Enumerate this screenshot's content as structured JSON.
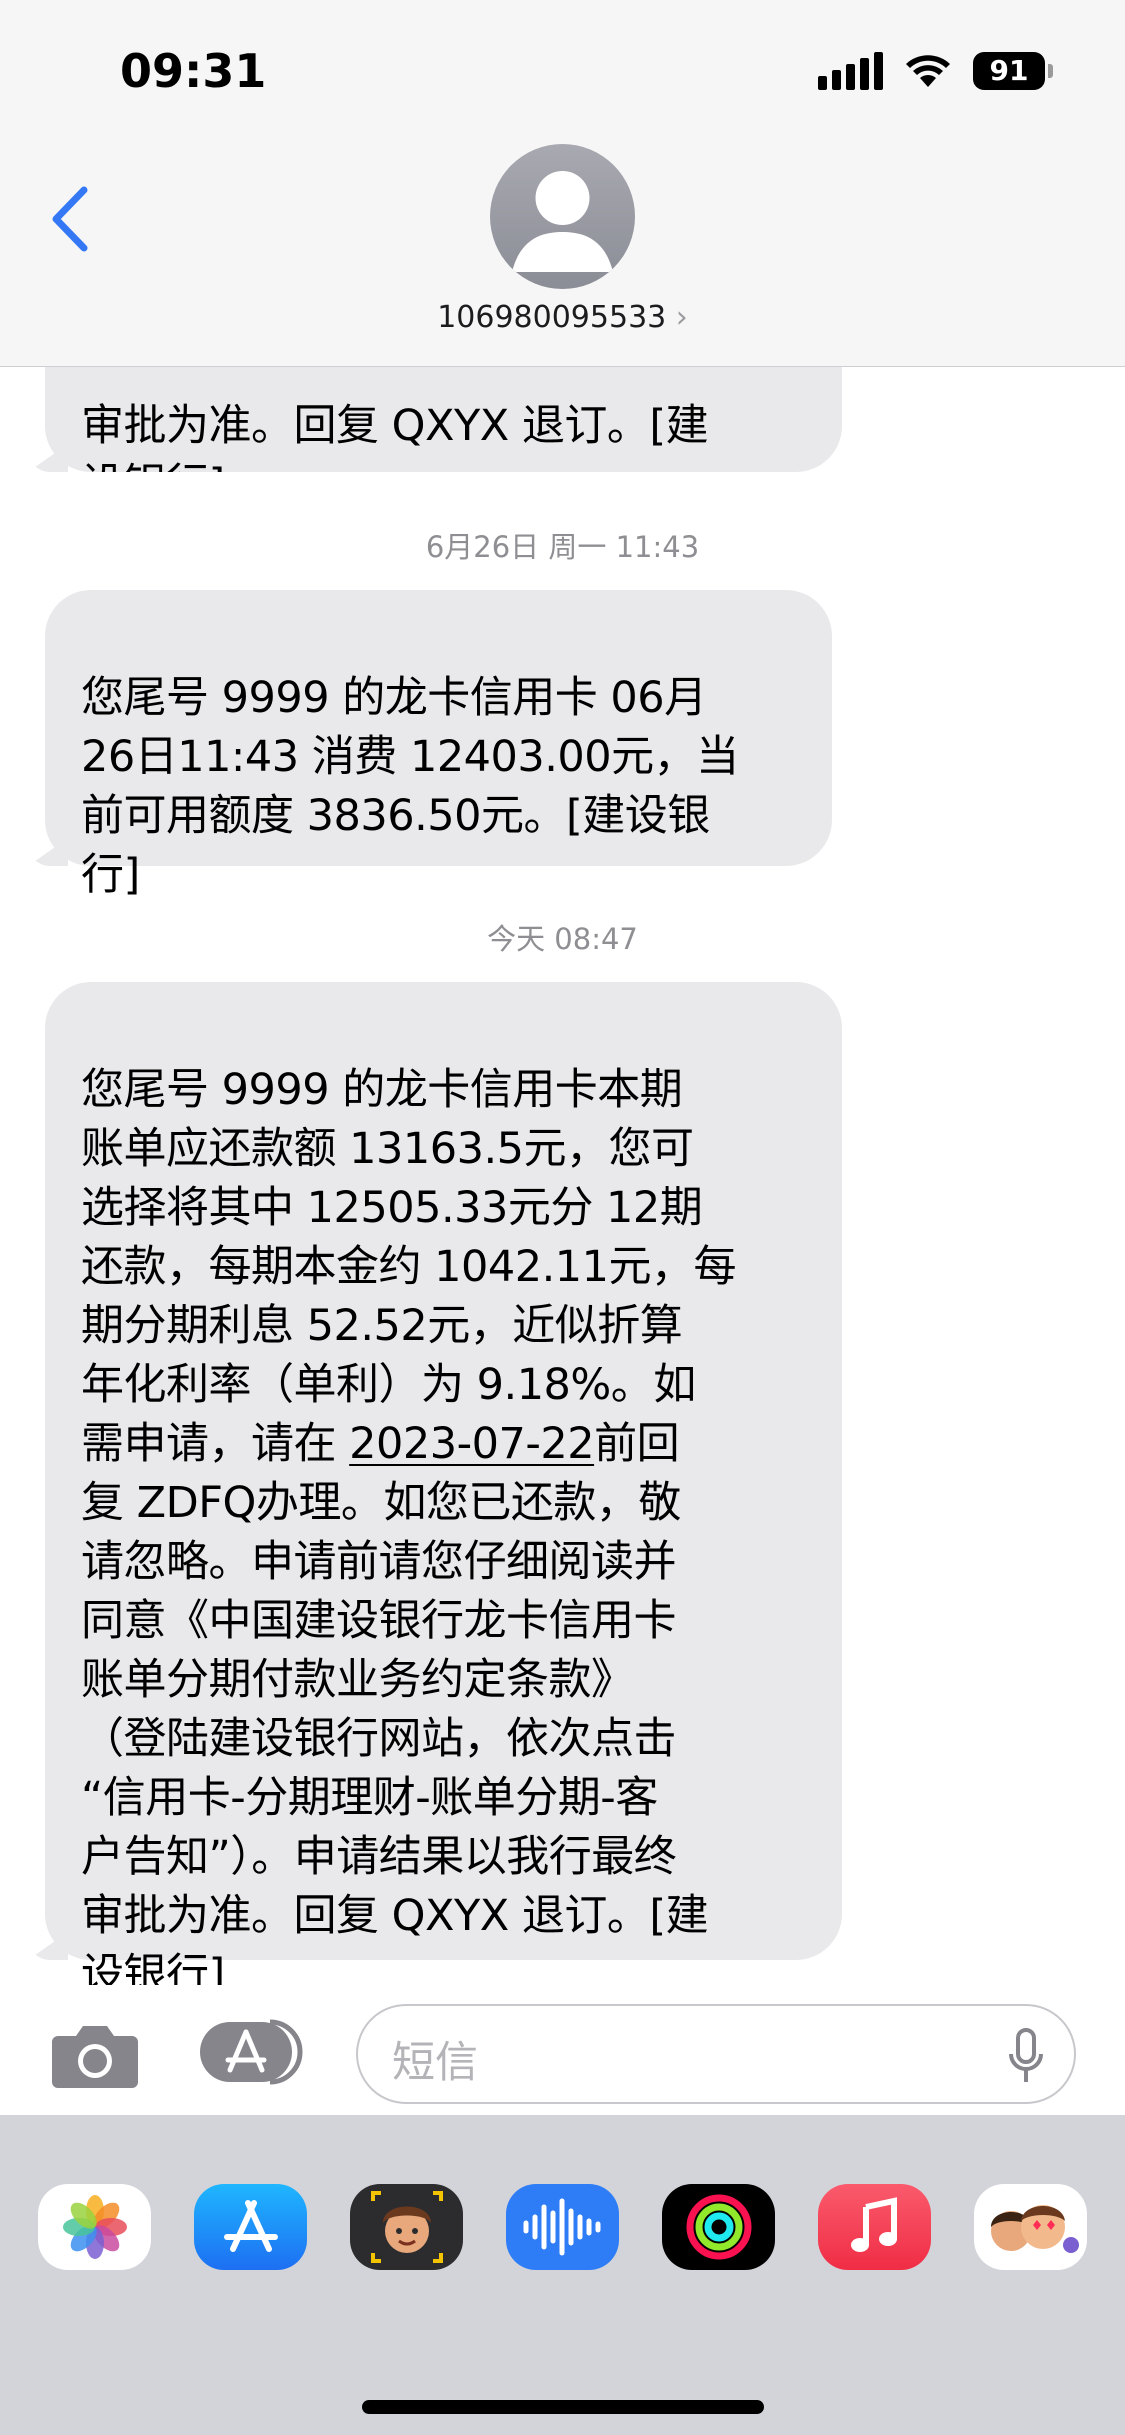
{
  "status_bar": {
    "time": "09:31",
    "battery": "91"
  },
  "header": {
    "contact_number": "106980095533",
    "chevron": "›"
  },
  "thread": {
    "messages": [
      {
        "text": "审批为准。回复 QXYX 退订。[建\n设银行]"
      },
      {
        "text": "您尾号 9999 的龙卡信用卡 06月\n26日11:43 消费 12403.00元，当\n前可用额度 3836.50元。[建设银\n行]"
      }
    ],
    "timestamps": [
      "6月26日 周一 11:43",
      "今天 08:47"
    ],
    "last_message": {
      "before": "您尾号 9999 的龙卡信用卡本期\n账单应还款额 13163.5元，您可\n选择将其中 12505.33元分 12期\n还款，每期本金约 1042.11元，每\n期分期利息 52.52元，近似折算\n年化利率（单利）为 9.18%。如\n需申请，请在 ",
      "date_link": "2023-07-22",
      "after": "前回\n复 ZDFQ办理。如您已还款，敬\n请忽略。申请前请您仔细阅读并\n同意《中国建设银行龙卡信用卡\n账单分期付款业务约定条款》\n（登陆建设银行网站，依次点击\n“信用卡-分期理财-账单分期-客\n户告知”）。申请结果以我行最终\n审批为准。回复 QXYX 退订。[建\n设银行]"
    }
  },
  "compose": {
    "placeholder": "短信"
  },
  "app_tray": {
    "icons": [
      "photos-icon",
      "app-store-icon",
      "memoji-icon",
      "audio-message-icon",
      "activity-icon",
      "music-icon",
      "stickers-icon"
    ]
  },
  "colors": {
    "bubble": "#e9e9eb",
    "accent": "#3478f6",
    "tray": "#d3d4d9"
  }
}
